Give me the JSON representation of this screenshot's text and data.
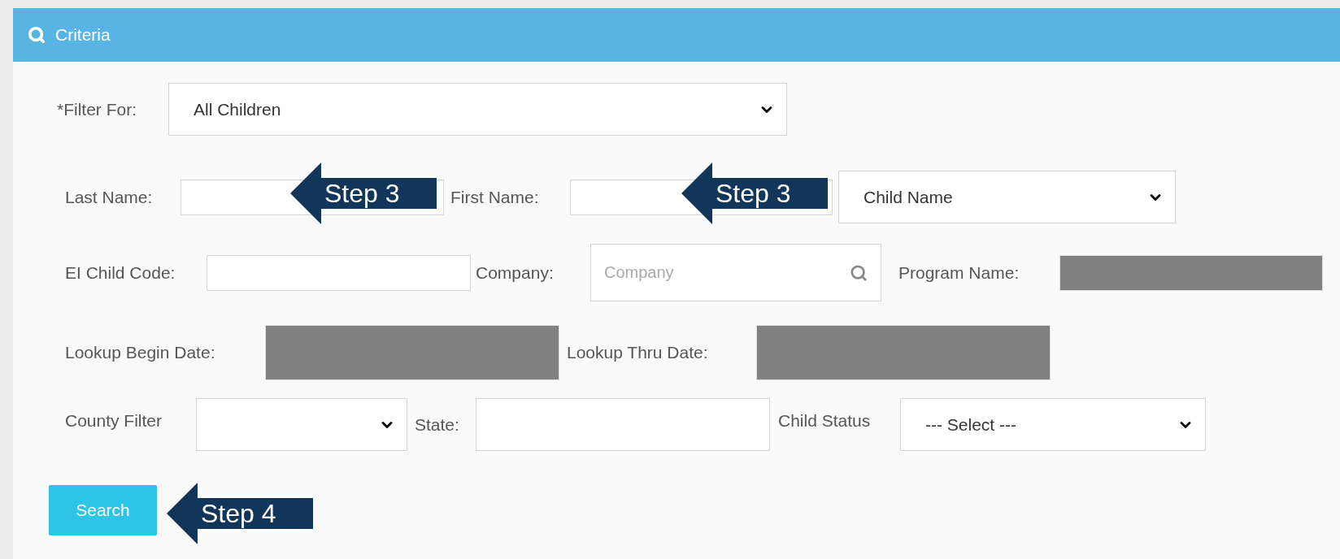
{
  "panel": {
    "title": "Criteria"
  },
  "rows": [
    {
      "items": [
        {
          "kind": "select",
          "label": "*Filter For:",
          "value": "All Children"
        }
      ]
    },
    {
      "items": [
        {
          "kind": "text",
          "label": "Last Name:"
        },
        {
          "kind": "text",
          "label": "First Name:"
        },
        {
          "kind": "select",
          "value": "Child Name"
        }
      ]
    },
    {
      "items": [
        {
          "kind": "text",
          "label": "EI Child Code:"
        },
        {
          "kind": "search",
          "label": "Company:",
          "placeholder": "Company"
        },
        {
          "kind": "redacted",
          "label": "Program Name:"
        }
      ]
    },
    {
      "items": [
        {
          "kind": "redacted",
          "label": "Lookup Begin Date:"
        },
        {
          "kind": "redacted",
          "label": "Lookup Thru Date:"
        }
      ]
    },
    {
      "items": [
        {
          "kind": "select",
          "label": "County Filter"
        },
        {
          "kind": "text",
          "label": "State:"
        },
        {
          "kind": "select",
          "label": "Child Status",
          "value": "--- Select ---"
        }
      ]
    }
  ],
  "search_button": "Search",
  "callouts": [
    {
      "text": "Step 3"
    },
    {
      "text": "Step 3"
    },
    {
      "text": "Step 4"
    }
  ]
}
